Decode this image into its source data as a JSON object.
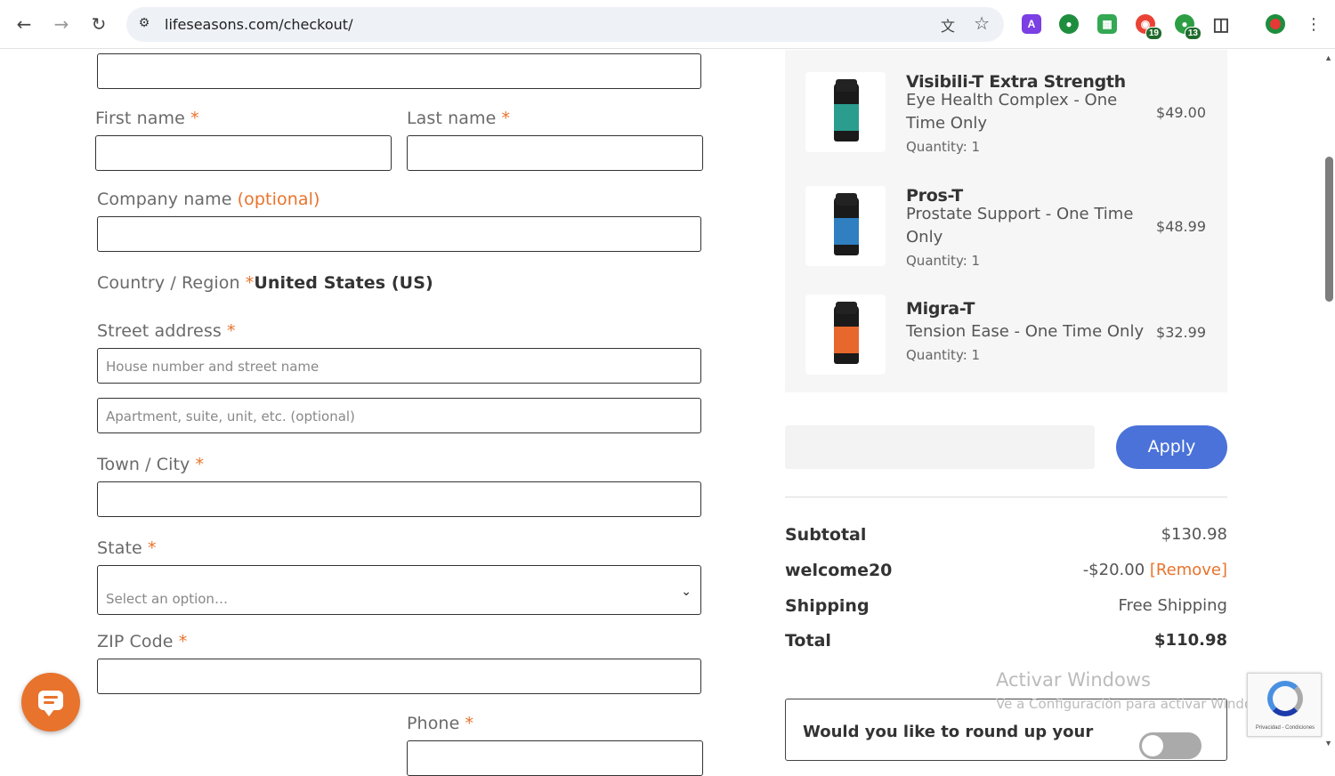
{
  "browser": {
    "url": "lifeseasons.com/checkout/",
    "extension_badges": [
      "19",
      "13"
    ]
  },
  "form": {
    "first_name_label": "First name",
    "last_name_label": "Last name",
    "company_label": "Company name",
    "company_optional": "(optional)",
    "country_label": "Country / Region",
    "country_value": "United States (US)",
    "street_label": "Street address",
    "street_placeholder_1": "House number and street name",
    "street_placeholder_2": "Apartment, suite, unit, etc. (optional)",
    "city_label": "Town / City",
    "state_label": "State",
    "state_placeholder": "Select an option…",
    "zip_label": "ZIP Code",
    "phone_label": "Phone",
    "required_mark": "*"
  },
  "order": {
    "items": [
      {
        "name": "Visibili-T Extra Strength",
        "desc": "Eye Health Complex - One Time Only",
        "qty": "Quantity: 1",
        "price": "$49.00",
        "color": "#2a9d8f"
      },
      {
        "name": "Pros-T",
        "desc": "Prostate Support - One Time Only",
        "qty": "Quantity: 1",
        "price": "$48.99",
        "color": "#2f7fc1"
      },
      {
        "name": "Migra-T",
        "desc": "Tension Ease - One Time Only",
        "qty": "Quantity: 1",
        "price": "$32.99",
        "color": "#e8672c"
      }
    ],
    "apply_label": "Apply",
    "subtotal_label": "Subtotal",
    "subtotal_value": "$130.98",
    "coupon_label": "welcome20",
    "coupon_value": "-$20.00",
    "remove_label": "[Remove]",
    "shipping_label": "Shipping",
    "shipping_value": "Free Shipping",
    "total_label": "Total",
    "total_value": "$110.98",
    "roundup_text": "Would you like to round up your"
  },
  "overlay": {
    "watermark_title": "Activar Windows",
    "watermark_sub": "Ve a Configuración para activar Windows.",
    "recaptcha_text": "Privacidad - Condiciones"
  },
  "colors": {
    "accent": "#e8732c",
    "apply_button": "#4a72d8"
  }
}
